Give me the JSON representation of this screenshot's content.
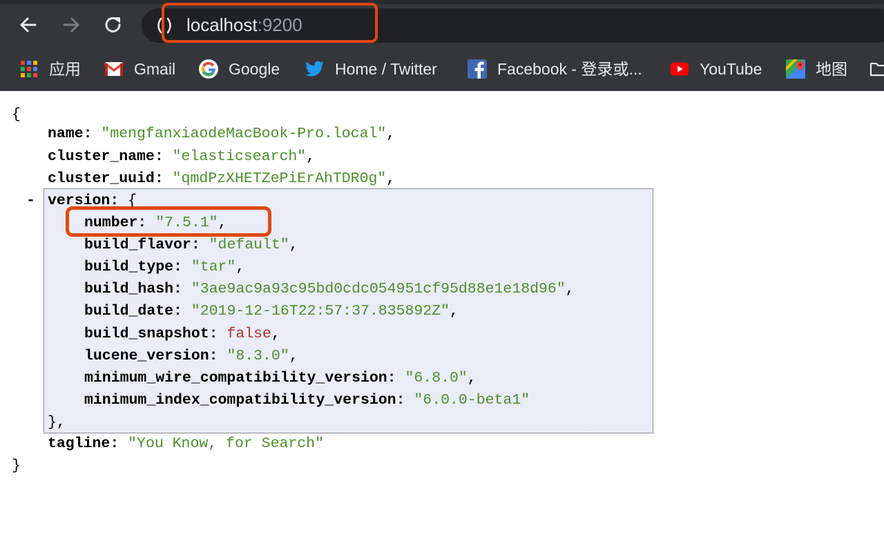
{
  "browser": {
    "url_host": "localhost",
    "url_port": ":9200",
    "bookmarks": [
      {
        "icon": "apps-grid-icon",
        "label": "应用"
      },
      {
        "icon": "gmail-icon",
        "label": "Gmail"
      },
      {
        "icon": "google-icon",
        "label": "Google"
      },
      {
        "icon": "twitter-icon",
        "label": "Home / Twitter"
      },
      {
        "icon": "facebook-icon",
        "label": "Facebook - 登录或..."
      },
      {
        "icon": "youtube-icon",
        "label": "YouTube"
      },
      {
        "icon": "maps-icon",
        "label": "地图"
      },
      {
        "icon": "folder-icon",
        "label": ""
      }
    ]
  },
  "json": {
    "open_brace": "{",
    "close_brace": "}",
    "collapse_toggle": "-",
    "name": {
      "key": "name",
      "value": "\"mengfanxiaodeMacBook-Pro.local\""
    },
    "cluster_name": {
      "key": "cluster_name",
      "value": "\"elasticsearch\""
    },
    "cluster_uuid": {
      "key": "cluster_uuid",
      "value": "\"qmdPzXHETZePiErAhTDR0g\""
    },
    "version": {
      "key": "version",
      "open": "{",
      "close": "},",
      "number": {
        "key": "number",
        "value": "\"7.5.1\""
      },
      "build_flavor": {
        "key": "build_flavor",
        "value": "\"default\""
      },
      "build_type": {
        "key": "build_type",
        "value": "\"tar\""
      },
      "build_hash": {
        "key": "build_hash",
        "value": "\"3ae9ac9a93c95bd0cdc054951cf95d88e1e18d96\""
      },
      "build_date": {
        "key": "build_date",
        "value": "\"2019-12-16T22:57:37.835892Z\""
      },
      "build_snapshot": {
        "key": "build_snapshot",
        "value": "false"
      },
      "lucene_version": {
        "key": "lucene_version",
        "value": "\"8.3.0\""
      },
      "minimum_wire_compatibility_version": {
        "key": "minimum_wire_compatibility_version",
        "value": "\"6.8.0\""
      },
      "minimum_index_compatibility_version": {
        "key": "minimum_index_compatibility_version",
        "value": "\"6.0.0-beta1\""
      }
    },
    "tagline": {
      "key": "tagline",
      "value": "\"You Know, for Search\""
    }
  },
  "colors": {
    "chrome_bg": "#35363a",
    "omnibox_bg": "#202124",
    "highlight": "#e2470f",
    "json_string": "#4d8f2a",
    "json_boolean": "#b0312f",
    "version_bg": "#eaecf7"
  }
}
